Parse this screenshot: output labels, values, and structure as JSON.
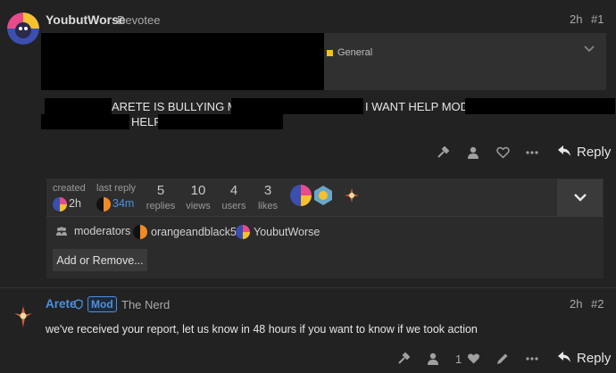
{
  "post1": {
    "username": "YoubutWorse",
    "user_title": "Devotee",
    "time": "2h",
    "post_number": "#1",
    "category": "General",
    "body_line1_mid": "ARETE IS BULLYING ME",
    "body_line1_end": "I WANT HELP MODS",
    "body_line2": "HELP",
    "reply_label": "Reply"
  },
  "topic_map": {
    "created_label": "created",
    "created_time": "2h",
    "last_reply_label": "last reply",
    "last_reply_time": "34m",
    "stats": [
      {
        "value": "5",
        "label": "replies"
      },
      {
        "value": "10",
        "label": "views"
      },
      {
        "value": "4",
        "label": "users"
      },
      {
        "value": "3",
        "label": "likes"
      }
    ],
    "group_label": "moderators",
    "member1": "orangeandblack5",
    "member2": "YoubutWorse",
    "add_remove_label": "Add or Remove..."
  },
  "post2": {
    "username": "Arete",
    "mod_badge": "Mod",
    "user_title": "The Nerd",
    "time": "2h",
    "post_number": "#2",
    "body": "we've received your report, let us know in 48 hours if you want to know if we took action",
    "like_count": "1",
    "reply_label": "Reply"
  },
  "colors": {
    "background": "#222222",
    "panel": "#2f2f2f",
    "accent_blue": "#4a90e2",
    "category_yellow": "#f1c40f"
  }
}
